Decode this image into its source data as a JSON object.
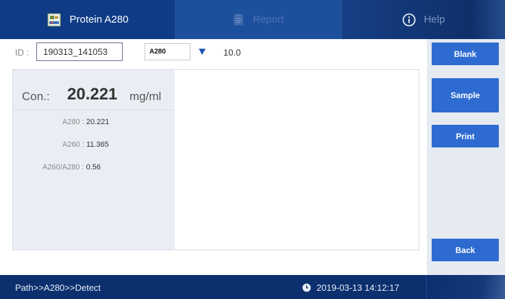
{
  "tabs": [
    {
      "label": "Protein A280",
      "icon": "protein-sample-icon"
    },
    {
      "label": "Report",
      "icon": "report-clipboard-icon"
    },
    {
      "label": "Help",
      "icon": "info-circle-icon"
    }
  ],
  "id_row": {
    "label": "ID :",
    "id_value": "190313_141053",
    "select_value": "A280",
    "factor_value": "10.0"
  },
  "result": {
    "con_label": "Con.:",
    "con_value": "20.221",
    "con_unit": "mg/ml",
    "measurements": [
      {
        "label": "A280 : ",
        "value": "20.221"
      },
      {
        "label": "A260 : ",
        "value": "11.365"
      },
      {
        "label": "A260/A280 : ",
        "value": "0.56"
      }
    ]
  },
  "buttons": {
    "blank": "Blank",
    "sample": "Sample",
    "print": "Print",
    "back": "Back"
  },
  "footer": {
    "path": "Path>>A280>>Detect",
    "datetime": "2019-03-13 14:12:17",
    "clock_icon": "clock-icon"
  },
  "colors": {
    "header_bg": "#0c2f6e",
    "button_blue": "#2d6bd0",
    "panel_left_bg": "#eaeef4"
  }
}
